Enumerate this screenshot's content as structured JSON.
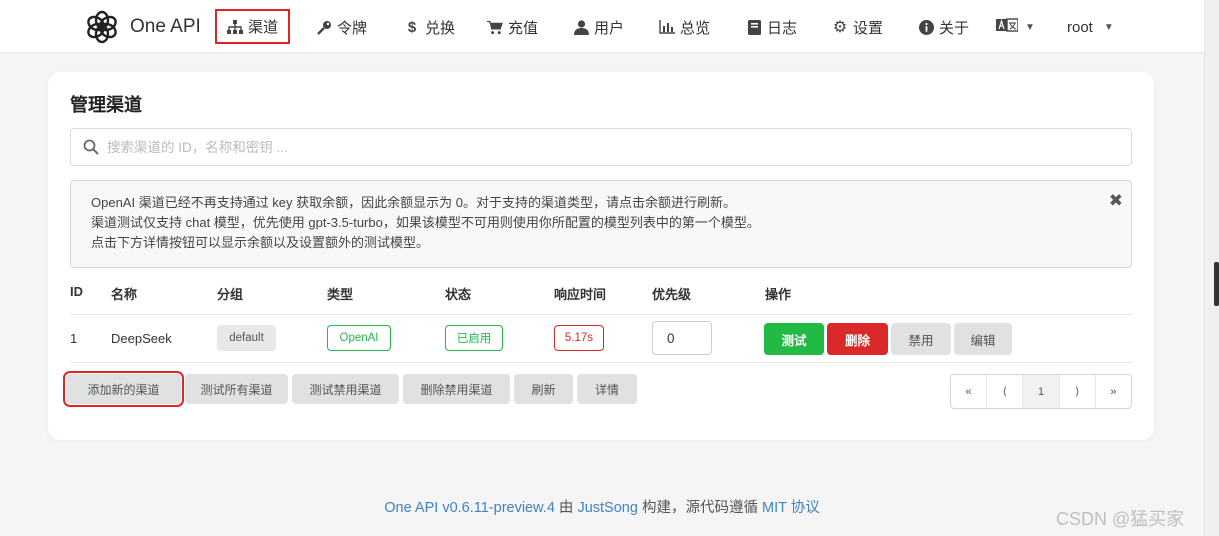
{
  "nav": {
    "brand": "One API",
    "items": [
      {
        "label": "渠道",
        "icon": "sitemap-icon"
      },
      {
        "label": "令牌",
        "icon": "key-icon"
      },
      {
        "label": "兑换",
        "icon": "dollar-icon"
      },
      {
        "label": "充值",
        "icon": "cart-icon"
      },
      {
        "label": "用户",
        "icon": "user-icon"
      },
      {
        "label": "总览",
        "icon": "chart-icon"
      },
      {
        "label": "日志",
        "icon": "book-icon"
      },
      {
        "label": "设置",
        "icon": "gear-icon"
      },
      {
        "label": "关于",
        "icon": "info-icon"
      }
    ],
    "user": "root"
  },
  "page": {
    "title": "管理渠道",
    "search_placeholder": "搜索渠道的 ID，名称和密钥 ...",
    "message": [
      "OpenAI 渠道已经不再支持通过 key 获取余额，因此余额显示为 0。对于支持的渠道类型，请点击余额进行刷新。",
      "渠道测试仅支持 chat 模型，优先使用 gpt-3.5-turbo，如果该模型不可用则使用你所配置的模型列表中的第一个模型。",
      "点击下方详情按钮可以显示余额以及设置额外的测试模型。"
    ]
  },
  "table": {
    "headers": [
      "ID",
      "名称",
      "分组",
      "类型",
      "状态",
      "响应时间",
      "优先级",
      "操作"
    ],
    "rows": [
      {
        "id": "1",
        "name": "DeepSeek",
        "group": "default",
        "type": "OpenAI",
        "status": "已启用",
        "response_time": "5.17s",
        "priority": "0"
      }
    ],
    "row_actions": [
      "测试",
      "删除",
      "禁用",
      "编辑"
    ]
  },
  "footer_buttons": [
    "添加新的渠道",
    "测试所有渠道",
    "测试禁用渠道",
    "删除禁用渠道",
    "刷新",
    "详情"
  ],
  "pagination": [
    "«",
    "⟨",
    "1",
    "⟩",
    "»"
  ],
  "footer": {
    "version": "One API v0.6.11-preview.4",
    "by": " 由 ",
    "author": "JustSong",
    "mid": " 构建，源代码遵循 ",
    "license": "MIT 协议"
  },
  "watermark": "CSDN @猛买家",
  "colors": {
    "green": "#21ba45",
    "red": "#db2828",
    "link": "#4183c4",
    "highlight": "#e02424"
  }
}
